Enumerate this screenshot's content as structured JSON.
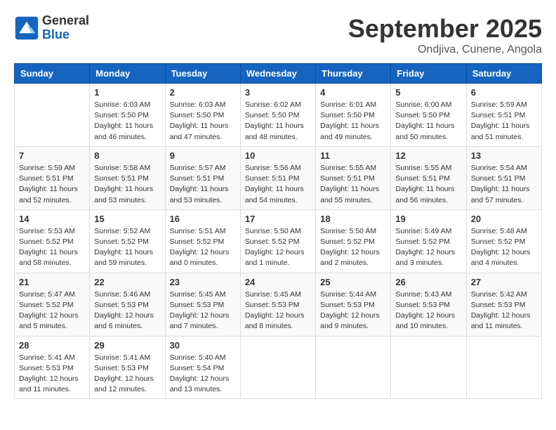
{
  "logo": {
    "line1": "General",
    "line2": "Blue"
  },
  "title": "September 2025",
  "location": "Ondjiva, Cunene, Angola",
  "weekdays": [
    "Sunday",
    "Monday",
    "Tuesday",
    "Wednesday",
    "Thursday",
    "Friday",
    "Saturday"
  ],
  "weeks": [
    [
      null,
      {
        "day": 1,
        "sunrise": "6:03 AM",
        "sunset": "5:50 PM",
        "daylight": "11 hours and 46 minutes."
      },
      {
        "day": 2,
        "sunrise": "6:03 AM",
        "sunset": "5:50 PM",
        "daylight": "11 hours and 47 minutes."
      },
      {
        "day": 3,
        "sunrise": "6:02 AM",
        "sunset": "5:50 PM",
        "daylight": "11 hours and 48 minutes."
      },
      {
        "day": 4,
        "sunrise": "6:01 AM",
        "sunset": "5:50 PM",
        "daylight": "11 hours and 49 minutes."
      },
      {
        "day": 5,
        "sunrise": "6:00 AM",
        "sunset": "5:50 PM",
        "daylight": "11 hours and 50 minutes."
      },
      {
        "day": 6,
        "sunrise": "5:59 AM",
        "sunset": "5:51 PM",
        "daylight": "11 hours and 51 minutes."
      }
    ],
    [
      {
        "day": 7,
        "sunrise": "5:59 AM",
        "sunset": "5:51 PM",
        "daylight": "11 hours and 52 minutes."
      },
      {
        "day": 8,
        "sunrise": "5:58 AM",
        "sunset": "5:51 PM",
        "daylight": "11 hours and 53 minutes."
      },
      {
        "day": 9,
        "sunrise": "5:57 AM",
        "sunset": "5:51 PM",
        "daylight": "11 hours and 53 minutes."
      },
      {
        "day": 10,
        "sunrise": "5:56 AM",
        "sunset": "5:51 PM",
        "daylight": "11 hours and 54 minutes."
      },
      {
        "day": 11,
        "sunrise": "5:55 AM",
        "sunset": "5:51 PM",
        "daylight": "11 hours and 55 minutes."
      },
      {
        "day": 12,
        "sunrise": "5:55 AM",
        "sunset": "5:51 PM",
        "daylight": "11 hours and 56 minutes."
      },
      {
        "day": 13,
        "sunrise": "5:54 AM",
        "sunset": "5:51 PM",
        "daylight": "11 hours and 57 minutes."
      }
    ],
    [
      {
        "day": 14,
        "sunrise": "5:53 AM",
        "sunset": "5:52 PM",
        "daylight": "11 hours and 58 minutes."
      },
      {
        "day": 15,
        "sunrise": "5:52 AM",
        "sunset": "5:52 PM",
        "daylight": "11 hours and 59 minutes."
      },
      {
        "day": 16,
        "sunrise": "5:51 AM",
        "sunset": "5:52 PM",
        "daylight": "12 hours and 0 minutes."
      },
      {
        "day": 17,
        "sunrise": "5:50 AM",
        "sunset": "5:52 PM",
        "daylight": "12 hours and 1 minute."
      },
      {
        "day": 18,
        "sunrise": "5:50 AM",
        "sunset": "5:52 PM",
        "daylight": "12 hours and 2 minutes."
      },
      {
        "day": 19,
        "sunrise": "5:49 AM",
        "sunset": "5:52 PM",
        "daylight": "12 hours and 3 minutes."
      },
      {
        "day": 20,
        "sunrise": "5:48 AM",
        "sunset": "5:52 PM",
        "daylight": "12 hours and 4 minutes."
      }
    ],
    [
      {
        "day": 21,
        "sunrise": "5:47 AM",
        "sunset": "5:52 PM",
        "daylight": "12 hours and 5 minutes."
      },
      {
        "day": 22,
        "sunrise": "5:46 AM",
        "sunset": "5:53 PM",
        "daylight": "12 hours and 6 minutes."
      },
      {
        "day": 23,
        "sunrise": "5:45 AM",
        "sunset": "5:53 PM",
        "daylight": "12 hours and 7 minutes."
      },
      {
        "day": 24,
        "sunrise": "5:45 AM",
        "sunset": "5:53 PM",
        "daylight": "12 hours and 8 minutes."
      },
      {
        "day": 25,
        "sunrise": "5:44 AM",
        "sunset": "5:53 PM",
        "daylight": "12 hours and 9 minutes."
      },
      {
        "day": 26,
        "sunrise": "5:43 AM",
        "sunset": "5:53 PM",
        "daylight": "12 hours and 10 minutes."
      },
      {
        "day": 27,
        "sunrise": "5:42 AM",
        "sunset": "5:53 PM",
        "daylight": "12 hours and 11 minutes."
      }
    ],
    [
      {
        "day": 28,
        "sunrise": "5:41 AM",
        "sunset": "5:53 PM",
        "daylight": "12 hours and 11 minutes."
      },
      {
        "day": 29,
        "sunrise": "5:41 AM",
        "sunset": "5:53 PM",
        "daylight": "12 hours and 12 minutes."
      },
      {
        "day": 30,
        "sunrise": "5:40 AM",
        "sunset": "5:54 PM",
        "daylight": "12 hours and 13 minutes."
      },
      null,
      null,
      null,
      null
    ]
  ],
  "labels": {
    "sunrise": "Sunrise:",
    "sunset": "Sunset:",
    "daylight": "Daylight:"
  }
}
